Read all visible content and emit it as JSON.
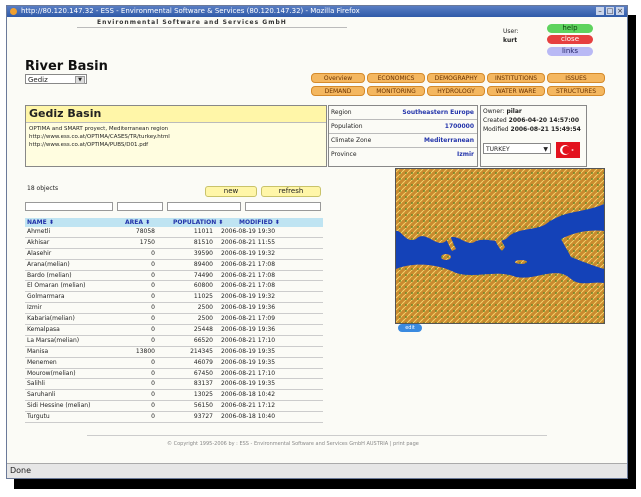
{
  "window": {
    "title": "http://80.120.147.32 - ESS - Environmental Software & Services (80.120.147.32) - Mozilla Firefox"
  },
  "company": "Environmental Software and Services GmbH",
  "user": {
    "label": "User:",
    "name": "kurt"
  },
  "side_buttons": {
    "help": "help",
    "close": "close",
    "links": "links"
  },
  "page_title": "River Basin",
  "basin_select": "Gediz",
  "nav": {
    "row1": [
      "Overview",
      "ECONOMICS",
      "DEMOGRAPHY",
      "INSTITUTIONS",
      "ISSUES"
    ],
    "row2": [
      "DEMAND",
      "MONITORING",
      "HYDROLOGY",
      "WATER WARE",
      "STRUCTURES"
    ]
  },
  "basin": {
    "name": "Gediz Basin",
    "desc": [
      "OPTIMA and SMART proyect, Mediterranean region",
      "http://www.ess.co.at/OPTIMA/CASES/TR/turkey.html",
      "http://www.ess.co.at/OPTIMA/PUBS/D01.pdf"
    ]
  },
  "info": [
    {
      "k": "Region",
      "v": "Southeastern Europe"
    },
    {
      "k": "Population",
      "v": "1700000"
    },
    {
      "k": "Climate Zone",
      "v": "Mediterranean"
    },
    {
      "k": "Province",
      "v": "Izmir"
    }
  ],
  "owner": {
    "owner_label": "Owner:",
    "owner": "pilar",
    "created_label": "Created",
    "created": "2006-04-20 14:57:00",
    "modified_label": "Modified",
    "modified": "2006-08-21 15:49:54",
    "country": "TURKEY"
  },
  "table": {
    "count": "18 objects",
    "new_label": "new",
    "refresh_label": "refresh",
    "headers": [
      "NAME ⬍",
      "AREA ⬍",
      "POPULATION ⬍",
      "MODIFIED ⬍"
    ],
    "rows": [
      [
        "Ahmetli",
        "78058",
        "11011",
        "2006-08-19 19:30"
      ],
      [
        "Akhisar",
        "1750",
        "81510",
        "2006-08-21 11:55"
      ],
      [
        "Alasehir",
        "0",
        "39590",
        "2006-08-19 19:32"
      ],
      [
        "Arana(melian)",
        "0",
        "89400",
        "2006-08-21 17:08"
      ],
      [
        "Bardo (melian)",
        "0",
        "74490",
        "2006-08-21 17:08"
      ],
      [
        "El Omaran (melian)",
        "0",
        "60800",
        "2006-08-21 17:08"
      ],
      [
        "Golmarmara",
        "0",
        "11025",
        "2006-08-19 19:32"
      ],
      [
        "Izmir",
        "0",
        "2500",
        "2006-08-19 19:36"
      ],
      [
        "Kabaria(melian)",
        "0",
        "2500",
        "2006-08-21 17:09"
      ],
      [
        "Kemalpasa",
        "0",
        "25448",
        "2006-08-19 19:36"
      ],
      [
        "La Marsa(melian)",
        "0",
        "66520",
        "2006-08-21 17:10"
      ],
      [
        "Manisa",
        "13800",
        "214345",
        "2006-08-19 19:35"
      ],
      [
        "Menemen",
        "0",
        "46079",
        "2006-08-19 19:35"
      ],
      [
        "Mourow(melian)",
        "0",
        "67450",
        "2006-08-21 17:10"
      ],
      [
        "Salihli",
        "0",
        "83137",
        "2006-08-19 19:35"
      ],
      [
        "Saruhanli",
        "0",
        "13025",
        "2006-08-18 10:42"
      ],
      [
        "Sidi Hessine (melian)",
        "0",
        "56150",
        "2006-08-21 17:12"
      ],
      [
        "Turgutu",
        "0",
        "93727",
        "2006-08-18 10:40"
      ]
    ]
  },
  "map_edit": "edit",
  "footer": "© Copyright 1995-2006 by : ESS - Environmental Software and Services GmbH AUSTRIA | print page",
  "status": "Done",
  "colors": {
    "nav_bg": "#f4b760",
    "help_bg": "#5ed35e",
    "close_bg": "#e64040",
    "links_bg": "#b9b9f5",
    "table_header": "#bfe4f2"
  }
}
